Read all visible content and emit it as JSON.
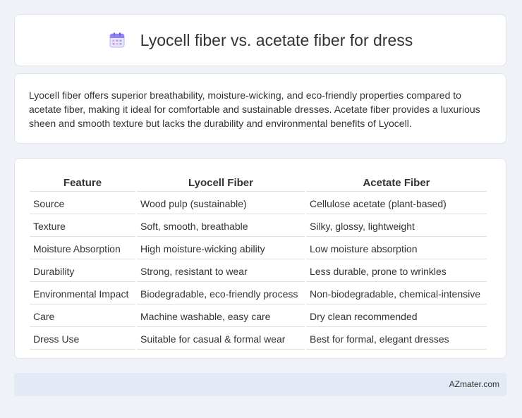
{
  "header": {
    "title": "Lyocell fiber vs. acetate fiber for dress",
    "icon": "calendar-icon"
  },
  "summary": {
    "text": "Lyocell fiber offers superior breathability, moisture-wicking, and eco-friendly properties compared to acetate fiber, making it ideal for comfortable and sustainable dresses. Acetate fiber provides a luxurious sheen and smooth texture but lacks the durability and environmental benefits of Lyocell."
  },
  "table": {
    "headers": [
      "Feature",
      "Lyocell Fiber",
      "Acetate Fiber"
    ],
    "rows": [
      [
        "Source",
        "Wood pulp (sustainable)",
        "Cellulose acetate (plant-based)"
      ],
      [
        "Texture",
        "Soft, smooth, breathable",
        "Silky, glossy, lightweight"
      ],
      [
        "Moisture Absorption",
        "High moisture-wicking ability",
        "Low moisture absorption"
      ],
      [
        "Durability",
        "Strong, resistant to wear",
        "Less durable, prone to wrinkles"
      ],
      [
        "Environmental Impact",
        "Biodegradable, eco-friendly process",
        "Non-biodegradable, chemical-intensive"
      ],
      [
        "Care",
        "Machine washable, easy care",
        "Dry clean recommended"
      ],
      [
        "Dress Use",
        "Suitable for casual & formal wear",
        "Best for formal, elegant dresses"
      ]
    ]
  },
  "footer": {
    "text": "AZmater.com"
  },
  "colors": {
    "background": "#eff2f7",
    "card": "#ffffff",
    "footer": "#e4eaf5",
    "icon_accent": "#7b6cf0"
  }
}
